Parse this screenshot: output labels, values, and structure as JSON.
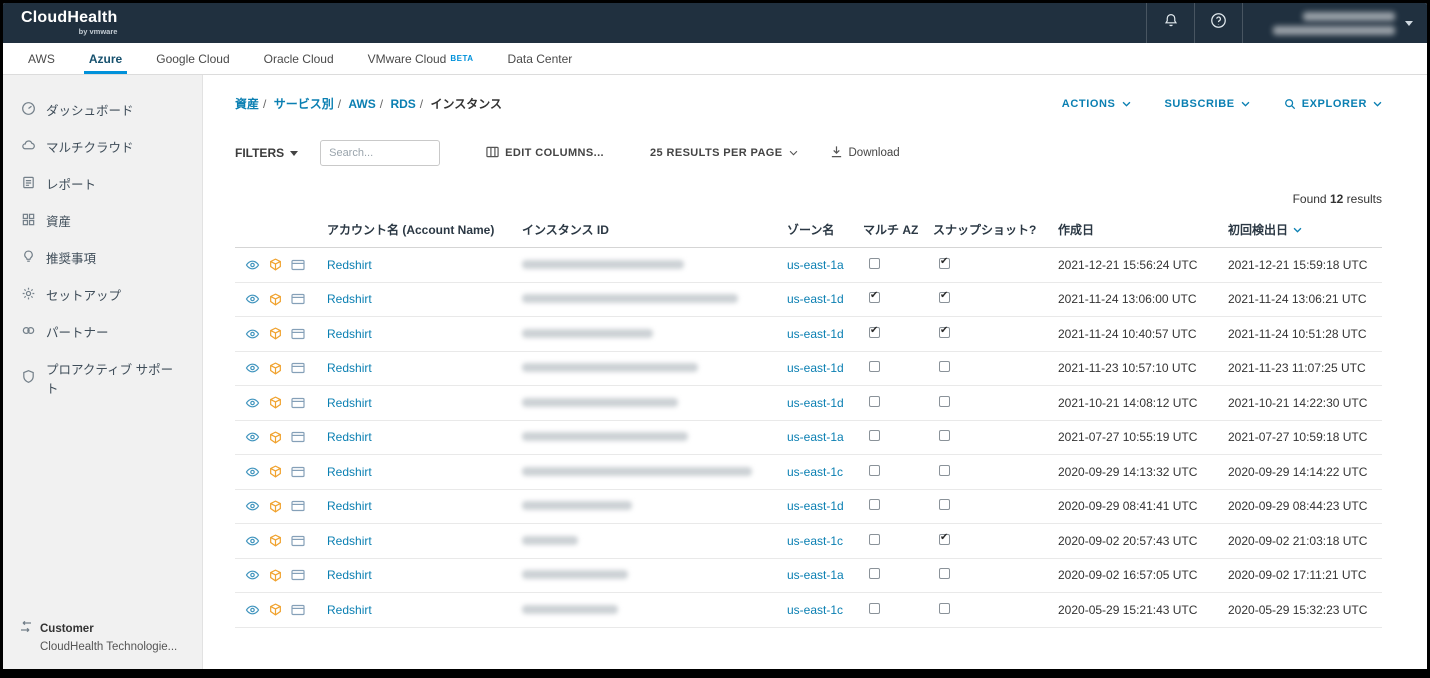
{
  "topbar": {
    "logo_title": "CloudHealth",
    "logo_subtitle": "by vmware"
  },
  "cloud_tabs": [
    {
      "label": "AWS",
      "active": false
    },
    {
      "label": "Azure",
      "active": true
    },
    {
      "label": "Google Cloud",
      "active": false
    },
    {
      "label": "Oracle Cloud",
      "active": false
    },
    {
      "label": "VMware Cloud",
      "badge": "BETA",
      "active": false
    },
    {
      "label": "Data Center",
      "active": false
    }
  ],
  "sidebar": {
    "items": [
      {
        "label": "ダッシュボード",
        "icon": "dashboard-icon"
      },
      {
        "label": "マルチクラウド",
        "icon": "multicloud-icon"
      },
      {
        "label": "レポート",
        "icon": "reports-icon"
      },
      {
        "label": "資産",
        "icon": "assets-icon"
      },
      {
        "label": "推奨事項",
        "icon": "recommendations-icon"
      },
      {
        "label": "セットアップ",
        "icon": "setup-icon"
      },
      {
        "label": "パートナー",
        "icon": "partner-icon"
      },
      {
        "label": "プロアクティブ サポート",
        "icon": "support-icon"
      }
    ],
    "footer": {
      "label": "Customer",
      "organization": "CloudHealth Technologie..."
    }
  },
  "breadcrumb": {
    "links": [
      "資産",
      "サービス別",
      "AWS",
      "RDS"
    ],
    "current": "インスタンス",
    "separator": "/"
  },
  "page_actions": {
    "actions_label": "ACTIONS",
    "subscribe_label": "SUBSCRIBE",
    "explorer_label": "EXPLORER"
  },
  "toolbar": {
    "filters_label": "FILTERS",
    "search_placeholder": "Search...",
    "edit_columns_label": "EDIT COLUMNS...",
    "per_page_label": "25 RESULTS PER PAGE",
    "download_label": "Download"
  },
  "results": {
    "prefix": "Found",
    "count": "12",
    "suffix": "results"
  },
  "table": {
    "columns": [
      "アカウント名 (Account Name)",
      "インスタンス ID",
      "ゾーン名",
      "マルチ AZ",
      "スナップショット?",
      "作成日",
      "初回検出日"
    ],
    "sorted_column": "初回検出日",
    "sort_direction": "desc",
    "row_icons": [
      "eye-icon",
      "perspective-cube-icon",
      "card-icon"
    ],
    "rows": [
      {
        "account": "Redshirt",
        "instance_id_redacted": true,
        "id_width": 162,
        "zone": "us-east-1a",
        "multi_az": false,
        "snapshot": true,
        "created": "2021-12-21 15:56:24 UTC",
        "first_discovered": "2021-12-21 15:59:18 UTC"
      },
      {
        "account": "Redshirt",
        "instance_id_redacted": true,
        "id_width": 216,
        "zone": "us-east-1d",
        "multi_az": true,
        "snapshot": true,
        "created": "2021-11-24 13:06:00 UTC",
        "first_discovered": "2021-11-24 13:06:21 UTC"
      },
      {
        "account": "Redshirt",
        "instance_id_redacted": true,
        "id_width": 131,
        "zone": "us-east-1d",
        "multi_az": true,
        "snapshot": true,
        "created": "2021-11-24 10:40:57 UTC",
        "first_discovered": "2021-11-24 10:51:28 UTC"
      },
      {
        "account": "Redshirt",
        "instance_id_redacted": true,
        "id_width": 176,
        "zone": "us-east-1d",
        "multi_az": false,
        "snapshot": false,
        "created": "2021-11-23 10:57:10 UTC",
        "first_discovered": "2021-11-23 11:07:25 UTC"
      },
      {
        "account": "Redshirt",
        "instance_id_redacted": true,
        "id_width": 156,
        "zone": "us-east-1d",
        "multi_az": false,
        "snapshot": false,
        "created": "2021-10-21 14:08:12 UTC",
        "first_discovered": "2021-10-21 14:22:30 UTC"
      },
      {
        "account": "Redshirt",
        "instance_id_redacted": true,
        "id_width": 166,
        "zone": "us-east-1a",
        "multi_az": false,
        "snapshot": false,
        "created": "2021-07-27 10:55:19 UTC",
        "first_discovered": "2021-07-27 10:59:18 UTC"
      },
      {
        "account": "Redshirt",
        "instance_id_redacted": true,
        "id_width": 230,
        "zone": "us-east-1c",
        "multi_az": false,
        "snapshot": false,
        "created": "2020-09-29 14:13:32 UTC",
        "first_discovered": "2020-09-29 14:14:22 UTC"
      },
      {
        "account": "Redshirt",
        "instance_id_redacted": true,
        "id_width": 110,
        "zone": "us-east-1d",
        "multi_az": false,
        "snapshot": false,
        "created": "2020-09-29 08:41:41 UTC",
        "first_discovered": "2020-09-29 08:44:23 UTC"
      },
      {
        "account": "Redshirt",
        "instance_id_redacted": true,
        "id_width": 56,
        "zone": "us-east-1c",
        "multi_az": false,
        "snapshot": true,
        "created": "2020-09-02 20:57:43 UTC",
        "first_discovered": "2020-09-02 21:03:18 UTC"
      },
      {
        "account": "Redshirt",
        "instance_id_redacted": true,
        "id_width": 106,
        "zone": "us-east-1a",
        "multi_az": false,
        "snapshot": false,
        "created": "2020-09-02 16:57:05 UTC",
        "first_discovered": "2020-09-02 17:11:21 UTC"
      },
      {
        "account": "Redshirt",
        "instance_id_redacted": true,
        "id_width": 96,
        "zone": "us-east-1c",
        "multi_az": false,
        "snapshot": false,
        "created": "2020-05-29 15:21:43 UTC",
        "first_discovered": "2020-05-29 15:32:23 UTC"
      }
    ]
  },
  "colors": {
    "topbar_bg": "#20303f",
    "link_blue": "#0a7fb2",
    "accent_blue": "#0091da",
    "icon_orange": "#f0a22e",
    "icon_teal": "#3e93bd",
    "icon_slate": "#85a0b8"
  }
}
